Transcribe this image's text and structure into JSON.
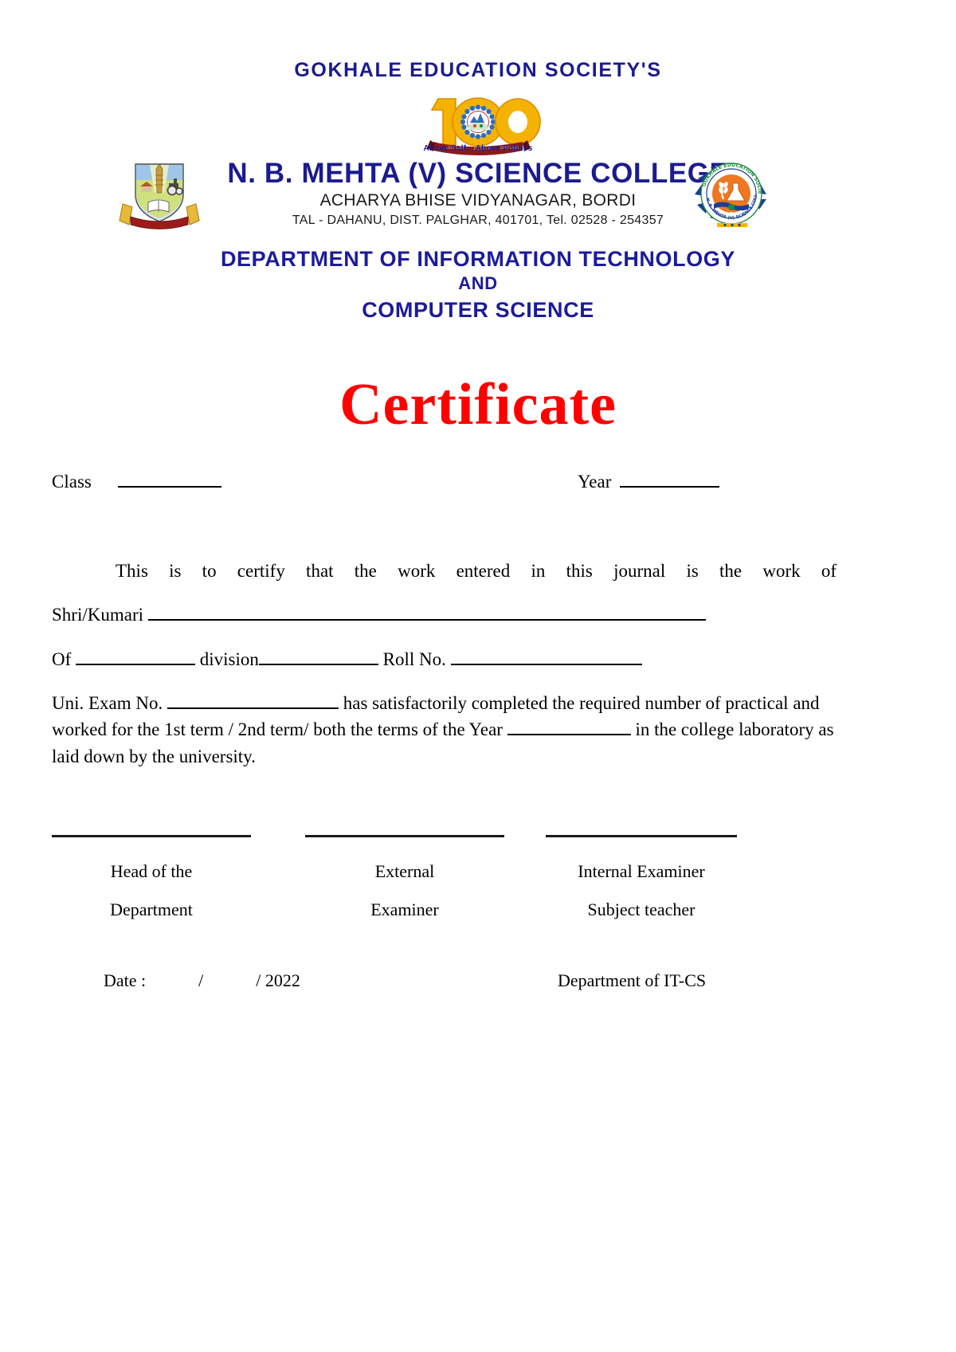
{
  "header": {
    "society": "GOKHALE EDUCATION SOCIETY'S",
    "centennial_number": "100",
    "tagline": "Above Self... Above Politics",
    "college_name": "N. B. MEHTA (V) SCIENCE COLLEGE",
    "address_line1": "ACHARYA BHISE VIDYANAGAR, BORDI",
    "address_line2": "TAL - DAHANU, DIST. PALGHAR, 401701, Tel.  02528 - 254357",
    "department_line1": "DEPARTMENT OF INFORMATION TECHNOLOGY",
    "department_line2": "AND",
    "department_line3": "COMPUTER SCIENCE",
    "seal_outer_text_top": "GOKHALE EDUCATION SOCIETY'S",
    "seal_outer_text_bottom": "N. B. MEHTA (V) SCIENCE COLLEGE BORDI",
    "colors": {
      "heading_blue": "#1b1b8f",
      "department_blue": "#1b1b9b",
      "title_red": "#ff0000",
      "logo_gold": "#f5b301",
      "ribbon_red": "#8b1a1a",
      "seal_orange": "#ef7722",
      "seal_blue": "#1b3f94",
      "seal_green": "#1f8a3b"
    }
  },
  "title": "Certificate",
  "form": {
    "class_label": "Class",
    "year_label": "Year",
    "certify_text": "This is to certify that the work entered in this journal is the work of",
    "shri_label": "Shri/Kumari",
    "of_label": "Of",
    "division_label": "division",
    "roll_label": "Roll No.",
    "uni_exam_label": "Uni. Exam No.",
    "exam_text_1": "has satisfactorily completed the required number of practical and",
    "exam_text_2a": "worked for the 1st term / 2nd term/ both  the terms of the Year",
    "exam_text_2b": "in the college laboratory",
    "exam_text_3": "as laid down by the university."
  },
  "signatures": [
    {
      "line1": "Head of the",
      "line2": "Department"
    },
    {
      "line1": "External",
      "line2": "Examiner"
    },
    {
      "line1": "Internal Examiner",
      "line2": "Subject teacher"
    }
  ],
  "footer": {
    "date_text": "Date :            /            / 2022",
    "department_short": "Department of IT-CS"
  }
}
